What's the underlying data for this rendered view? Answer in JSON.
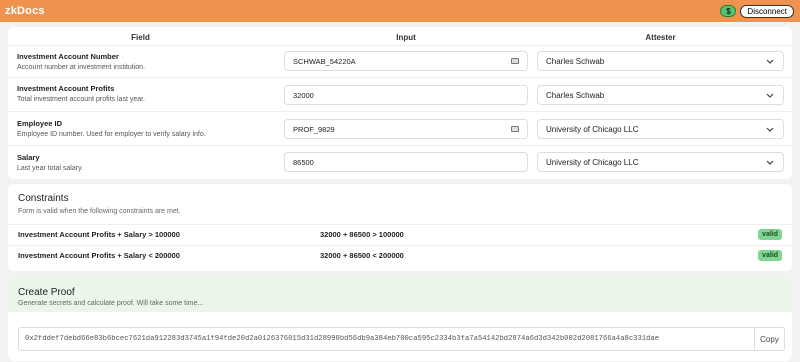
{
  "header": {
    "brand": "zkDocs",
    "balance_symbol": "$",
    "disconnect_label": "Disconnect"
  },
  "table": {
    "columns": [
      "Field",
      "Input",
      "Attester"
    ],
    "rows": [
      {
        "name": "Investment Account Number",
        "desc": "Account number at investment institution.",
        "input": "SCHWAB_54220A",
        "secret": true,
        "attester": "Charles Schwab"
      },
      {
        "name": "Investment Account Profits",
        "desc": "Total investment account profits last year.",
        "input": "32000",
        "secret": false,
        "attester": "Charles Schwab"
      },
      {
        "name": "Employee ID",
        "desc": "Employee ID number. Used for employer to verify salary info.",
        "input": "PROF_9829",
        "secret": true,
        "attester": "University of Chicago LLC"
      },
      {
        "name": "Salary",
        "desc": "Last year total salary.",
        "input": "86500",
        "secret": false,
        "attester": "University of Chicago LLC"
      }
    ]
  },
  "constraints": {
    "title": "Constraints",
    "subtitle": "Form is valid when the following constraints are met.",
    "items": [
      {
        "text": "Investment Account Profits + Salary > 100000",
        "calc": "32000  +  86500  >  100000",
        "status": "valid"
      },
      {
        "text": "Investment Account Profits + Salary < 200000",
        "calc": "32000  +  86500  <  200000",
        "status": "valid"
      }
    ]
  },
  "proof": {
    "title": "Create Proof",
    "subtitle": "Generate secrets and calculate proof. Will take some time...",
    "value": "0x2fddef7debd66e83b6bcec7621da912283d3745a1f94fde20d2a0126376015d31d28990bd56db9a384eb700ca595c2334b3fa7a54142bd2874a6d3d342b002d2081766a4a8c331dae",
    "copy_label": "Copy"
  },
  "colors": {
    "accent": "#f0934e",
    "valid": "#7fd691",
    "proof_header": "#eaf6ea"
  }
}
